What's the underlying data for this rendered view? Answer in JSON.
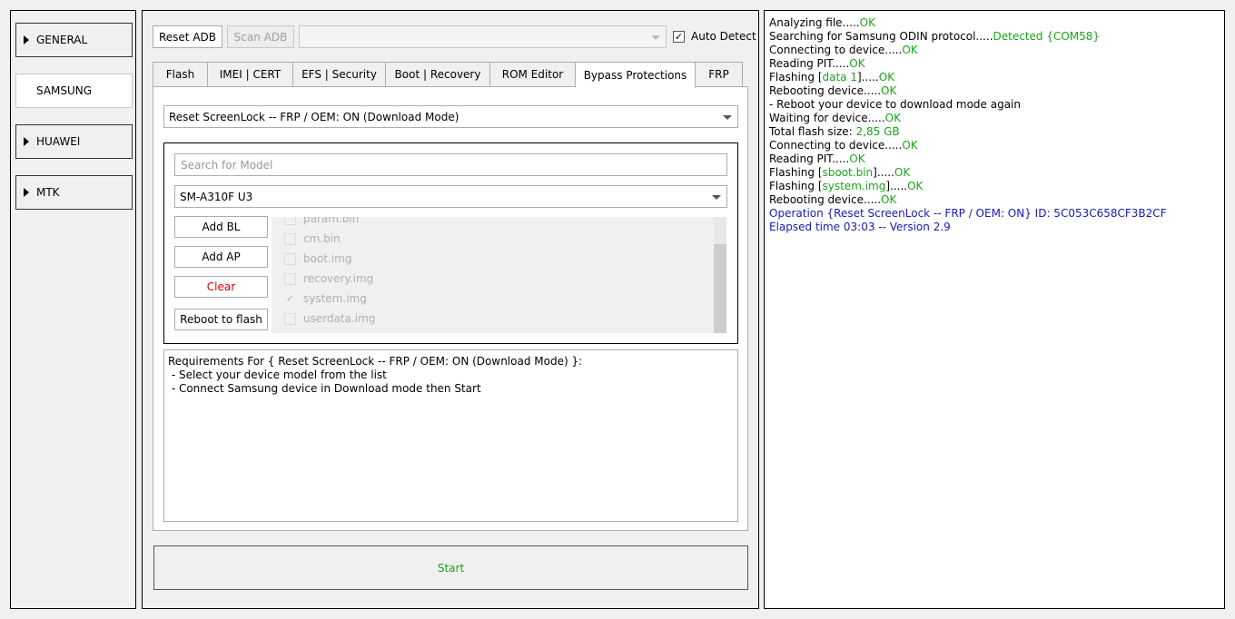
{
  "colors": {
    "ok": "#1aa51a",
    "info": "#1a1ab4",
    "error": "#d40000",
    "start": "#1aa51a"
  },
  "nav": [
    {
      "label": "GENERAL",
      "active": false
    },
    {
      "label": "SAMSUNG",
      "active": true
    },
    {
      "label": "HUAWEI",
      "active": false
    },
    {
      "label": "MTK",
      "active": false
    }
  ],
  "toolbar": {
    "reset_adb": "Reset ADB",
    "scan_adb": "Scan ADB",
    "port_value": "",
    "auto_detect_label": "Auto Detect",
    "auto_detect_checked": true
  },
  "tabs": [
    "Flash",
    "IMEI | CERT",
    "EFS | Security",
    "Boot | Recovery",
    "ROM Editor",
    "Bypass Protections",
    "FRP"
  ],
  "active_tab": "Bypass Protections",
  "operation_select": "Reset ScreenLock -- FRP / OEM: ON (Download Mode)",
  "model": {
    "search_placeholder": "Search for Model",
    "selected": "SM-A310F U3"
  },
  "file_buttons": {
    "add_bl": "Add BL",
    "add_ap": "Add AP",
    "clear": "Clear",
    "reboot": "Reboot to flash"
  },
  "files": [
    {
      "name": "param.bin",
      "checked": false
    },
    {
      "name": "cm.bin",
      "checked": false
    },
    {
      "name": "boot.img",
      "checked": false
    },
    {
      "name": "recovery.img",
      "checked": false
    },
    {
      "name": "system.img",
      "checked": true
    },
    {
      "name": "userdata.img",
      "checked": false
    }
  ],
  "requirements": [
    "Requirements For { Reset ScreenLock -- FRP / OEM: ON (Download Mode) }:",
    " - Select your device model from the list",
    " - Connect Samsung device in Download mode then Start"
  ],
  "start_label": "Start",
  "log": [
    [
      {
        "t": "Analyzing file....."
      },
      {
        "t": "OK",
        "c": "ok"
      }
    ],
    [
      {
        "t": "Searching for Samsung ODIN protocol....."
      },
      {
        "t": "Detected {COM58}",
        "c": "ok"
      }
    ],
    [
      {
        "t": "Connecting to device....."
      },
      {
        "t": "OK",
        "c": "ok"
      }
    ],
    [
      {
        "t": "Reading PIT....."
      },
      {
        "t": "OK",
        "c": "ok"
      }
    ],
    [
      {
        "t": "Flashing ["
      },
      {
        "t": "data 1",
        "c": "ok"
      },
      {
        "t": "]....."
      },
      {
        "t": "OK",
        "c": "ok"
      }
    ],
    [
      {
        "t": "Rebooting device....."
      },
      {
        "t": "OK",
        "c": "ok"
      }
    ],
    [
      {
        "t": " - Reboot your device to download mode again"
      }
    ],
    [
      {
        "t": "Waiting for device....."
      },
      {
        "t": "OK",
        "c": "ok"
      }
    ],
    [
      {
        "t": "Total flash size: "
      },
      {
        "t": "2,85 GB",
        "c": "ok"
      }
    ],
    [
      {
        "t": "Connecting to device....."
      },
      {
        "t": "OK",
        "c": "ok"
      }
    ],
    [
      {
        "t": "Reading PIT....."
      },
      {
        "t": "OK",
        "c": "ok"
      }
    ],
    [
      {
        "t": "Flashing ["
      },
      {
        "t": "sboot.bin",
        "c": "ok"
      },
      {
        "t": "]....."
      },
      {
        "t": "OK",
        "c": "ok"
      }
    ],
    [
      {
        "t": "Flashing ["
      },
      {
        "t": "system.img",
        "c": "ok"
      },
      {
        "t": "]....."
      },
      {
        "t": "OK",
        "c": "ok"
      }
    ],
    [
      {
        "t": "Rebooting device....."
      },
      {
        "t": "OK",
        "c": "ok"
      }
    ],
    [
      {
        "t": "Operation {Reset ScreenLock -- FRP / OEM: ON} ID: 5C053C658CF3B2CF",
        "c": "info"
      }
    ],
    [
      {
        "t": "Elapsed time 03:03 -- Version 2.9",
        "c": "info"
      }
    ]
  ]
}
